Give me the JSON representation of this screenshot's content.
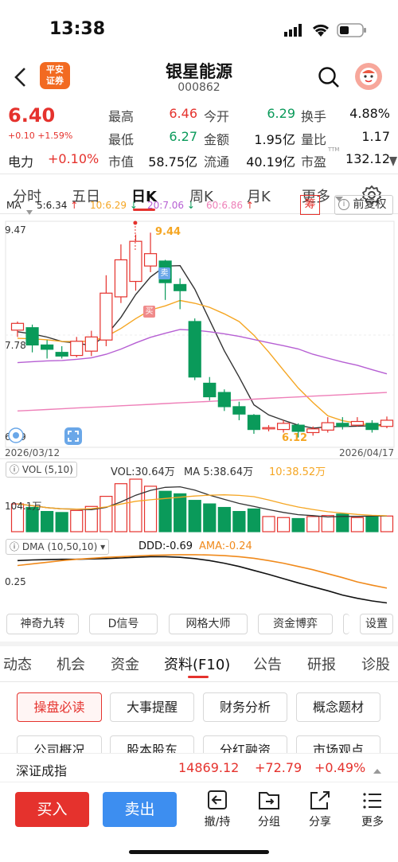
{
  "status": {
    "time": "13:38"
  },
  "header": {
    "name": "银星能源",
    "code": "000862",
    "logo_line1": "平安",
    "logo_line2": "证券"
  },
  "quote": {
    "price": "6.40",
    "change": "+0.10 +1.59%",
    "sector": "电力",
    "sector_pct": "+0.10%",
    "rows": [
      [
        {
          "k": "最高",
          "v": "6.46",
          "c": "red"
        },
        {
          "k": "今开",
          "v": "6.29",
          "c": "green"
        },
        {
          "k": "换手",
          "v": "4.88%",
          "c": "dark"
        }
      ],
      [
        {
          "k": "最低",
          "v": "6.27",
          "c": "green"
        },
        {
          "k": "金额",
          "v": "1.95亿",
          "c": "dark"
        },
        {
          "k": "量比",
          "v": "1.17",
          "c": "dark"
        }
      ],
      [
        {
          "k": "市值",
          "v": "58.75亿",
          "c": "dark"
        },
        {
          "k": "流通",
          "v": "40.19亿",
          "c": "dark"
        },
        {
          "k": "市盈",
          "v": "132.12",
          "c": "dark",
          "sup": "TTM"
        }
      ]
    ]
  },
  "tabs": [
    "分时",
    "五日",
    "日K",
    "周K",
    "月K",
    "更多"
  ],
  "ma": {
    "label": "MA",
    "ma5": "5:6.34",
    "ma10": "10:6.29",
    "ma20": "20:7.06",
    "ma60": "60:6.86",
    "chou": "筹",
    "fuquan": "前复权"
  },
  "kline": {
    "high_label": "9.47",
    "mid_label": "7.78",
    "low_label": "6.09",
    "start_date": "2026/03/12",
    "end_date": "2026/04/17",
    "max_marker": "9.44",
    "min_marker": "6.12",
    "sell_tag": "卖",
    "buy_tag": "买"
  },
  "vol": {
    "title": "VOL (5,10)",
    "vol": "VOL:30.64万",
    "ma5": "MA  5:38.64万",
    "ma10": "10:38.52万",
    "axis": "104.1万"
  },
  "dma": {
    "title": "DMA (10,50,10)",
    "ddd": "DDD:-0.69",
    "ama": "AMA:-0.24",
    "axis": "0.25"
  },
  "indicators": [
    "神奇九转",
    "D信号",
    "网格大师",
    "资金博弈",
    "设置"
  ],
  "sub_tabs": [
    "动态",
    "机会",
    "资金",
    "资料(F10)",
    "公告",
    "研报",
    "诊股"
  ],
  "chips_row1": [
    "操盘必读",
    "大事提醒",
    "财务分析",
    "概念题材"
  ],
  "chips_row2": [
    "公司概况",
    "股本股东",
    "分红融资",
    "市场观点"
  ],
  "index_bar": {
    "name": "深证成指",
    "value": "14869.12",
    "change": "+72.79",
    "pct": "+0.49%"
  },
  "bottom": {
    "buy": "买入",
    "sell": "卖出",
    "tools": [
      "撤/持",
      "分组",
      "分享",
      "更多"
    ]
  },
  "colors": {
    "up": "#e5322d",
    "down": "#0a9a5a",
    "ma5": "#333333",
    "ma10": "#f5a623",
    "ma20": "#b65fd3",
    "ma60": "#ee7fb8",
    "dma": "#111111",
    "ama": "#f08a1c"
  },
  "chart_data": {
    "type": "candlestick",
    "x_start": "2026/03/12",
    "x_end": "2026/04/17",
    "y_range": [
      6.09,
      9.47
    ],
    "candles": [
      {
        "o": 7.86,
        "c": 7.97,
        "h": 8.0,
        "l": 7.75
      },
      {
        "o": 7.9,
        "c": 7.62,
        "h": 7.95,
        "l": 7.5
      },
      {
        "o": 7.62,
        "c": 7.55,
        "h": 7.7,
        "l": 7.4
      },
      {
        "o": 7.5,
        "c": 7.44,
        "h": 7.6,
        "l": 7.4
      },
      {
        "o": 7.45,
        "c": 7.68,
        "h": 7.75,
        "l": 7.42
      },
      {
        "o": 7.52,
        "c": 7.75,
        "h": 7.85,
        "l": 7.44
      },
      {
        "o": 7.7,
        "c": 8.46,
        "h": 8.75,
        "l": 7.6
      },
      {
        "o": 8.4,
        "c": 9.0,
        "h": 9.25,
        "l": 8.3
      },
      {
        "o": 8.65,
        "c": 9.3,
        "h": 9.41,
        "l": 8.5
      },
      {
        "o": 8.9,
        "c": 9.1,
        "h": 9.44,
        "l": 8.8
      },
      {
        "o": 8.98,
        "c": 8.63,
        "h": 9.0,
        "l": 8.35
      },
      {
        "o": 8.6,
        "c": 8.5,
        "h": 8.7,
        "l": 8.2
      },
      {
        "o": 8.0,
        "c": 7.1,
        "h": 8.05,
        "l": 7.05
      },
      {
        "o": 7.0,
        "c": 6.78,
        "h": 7.1,
        "l": 6.72
      },
      {
        "o": 6.85,
        "c": 6.62,
        "h": 6.9,
        "l": 6.55
      },
      {
        "o": 6.62,
        "c": 6.5,
        "h": 6.7,
        "l": 6.4
      },
      {
        "o": 6.48,
        "c": 6.25,
        "h": 6.5,
        "l": 6.18
      },
      {
        "o": 6.26,
        "c": 6.28,
        "h": 6.32,
        "l": 6.22
      },
      {
        "o": 6.25,
        "c": 6.35,
        "h": 6.4,
        "l": 6.2
      },
      {
        "o": 6.32,
        "c": 6.22,
        "h": 6.35,
        "l": 6.12
      },
      {
        "o": 6.2,
        "c": 6.26,
        "h": 6.3,
        "l": 6.15
      },
      {
        "o": 6.24,
        "c": 6.36,
        "h": 6.45,
        "l": 6.2
      },
      {
        "o": 6.35,
        "c": 6.3,
        "h": 6.45,
        "l": 6.25
      },
      {
        "o": 6.32,
        "c": 6.38,
        "h": 6.45,
        "l": 6.3
      },
      {
        "o": 6.35,
        "c": 6.25,
        "h": 6.4,
        "l": 6.2
      },
      {
        "o": 6.3,
        "c": 6.4,
        "h": 6.46,
        "l": 6.27
      }
    ],
    "volume": [
      55,
      48,
      40,
      38,
      42,
      50,
      70,
      95,
      104,
      90,
      80,
      75,
      62,
      55,
      48,
      40,
      45,
      30,
      28,
      26,
      30,
      32,
      35,
      28,
      30,
      31
    ],
    "dma": [
      0.6,
      0.62,
      0.63,
      0.64,
      0.64,
      0.65,
      0.66,
      0.68,
      0.7,
      0.72,
      0.72,
      0.7,
      0.66,
      0.6,
      0.52,
      0.42,
      0.3,
      0.18,
      0.05,
      -0.08,
      -0.2,
      -0.32,
      -0.45,
      -0.55,
      -0.63,
      -0.69
    ],
    "ama": [
      0.45,
      0.5,
      0.55,
      0.6,
      0.64,
      0.67,
      0.7,
      0.72,
      0.74,
      0.76,
      0.77,
      0.78,
      0.78,
      0.77,
      0.75,
      0.72,
      0.67,
      0.6,
      0.52,
      0.42,
      0.32,
      0.2,
      0.08,
      -0.05,
      -0.15,
      -0.24
    ]
  }
}
